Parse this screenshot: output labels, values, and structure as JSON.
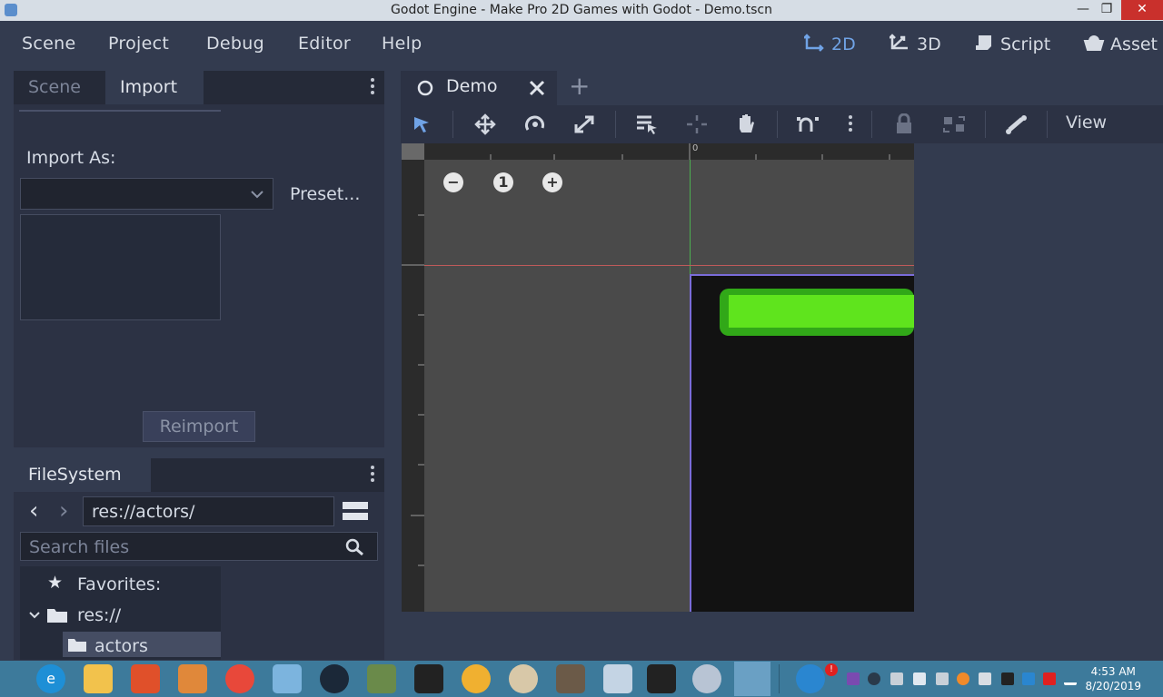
{
  "window": {
    "title": "Godot Engine - Make Pro 2D Games with Godot - Demo.tscn",
    "minimize": "—",
    "maximize": "❐",
    "close": "✕"
  },
  "menu": {
    "items": [
      "Scene",
      "Project",
      "Debug",
      "Editor",
      "Help"
    ],
    "modes": [
      {
        "label": "2D",
        "icon": "2d-mode-icon",
        "active": true
      },
      {
        "label": "3D",
        "icon": "3d-mode-icon",
        "active": false
      },
      {
        "label": "Script",
        "icon": "script-icon",
        "active": false
      },
      {
        "label": "Asset",
        "icon": "assetlib-icon",
        "active": false
      }
    ]
  },
  "import_dock": {
    "tabs": [
      "Scene",
      "Import"
    ],
    "active_tab": "Import",
    "import_as_label": "Import As:",
    "import_as_value": "",
    "preset_label": "Preset...",
    "reimport_label": "Reimport"
  },
  "filesystem": {
    "tab": "FileSystem",
    "back": "‹",
    "forward": "›",
    "path": "res://actors/",
    "search_placeholder": "Search files",
    "tree": {
      "favorites": "Favorites:",
      "root": "res://",
      "child": "actors"
    }
  },
  "editor": {
    "scene_tab": "Demo",
    "add_tab": "+",
    "view_menu": "View",
    "ruler_origin": "0",
    "zoom": {
      "minus": "−",
      "reset": "1",
      "plus": "+"
    }
  },
  "colors": {
    "accent": "#70a3e6",
    "game_border": "#7a6cd8",
    "health_bar": "#5fe41d",
    "health_bar_edge": "#31a818"
  },
  "taskbar": {
    "apps": [
      "internet-explorer",
      "file-explorer",
      "app-orange",
      "app-paint",
      "chrome",
      "app-blue",
      "steam",
      "app-green",
      "unity",
      "app-fruit",
      "paint-palette",
      "gimp",
      "app-monitor",
      "unity-2",
      "app-swirl",
      "godot"
    ],
    "notification_badge": "!",
    "clock_time": "4:53 AM",
    "clock_date": "8/20/2019"
  }
}
